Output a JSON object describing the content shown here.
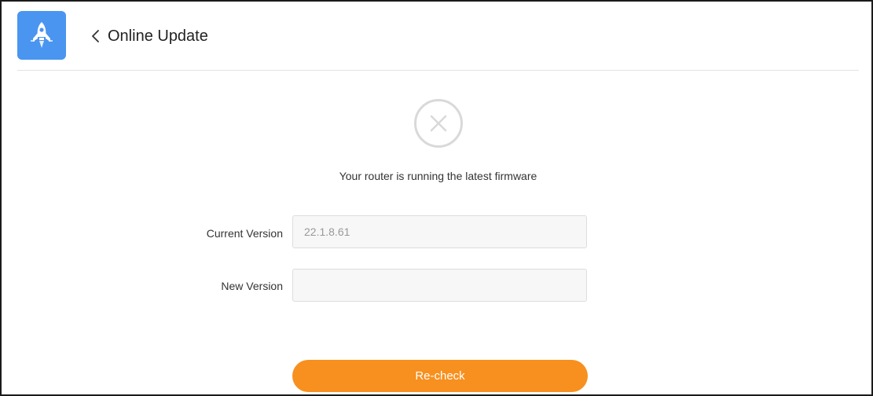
{
  "header": {
    "app_icon": "rocket-icon",
    "back_icon": "chevron-left-icon",
    "title": "Online Update"
  },
  "status": {
    "icon": "x-circle-icon",
    "message": "Your router is running the latest firmware"
  },
  "form": {
    "current_version": {
      "label": "Current Version",
      "value": "22.1.8.61"
    },
    "new_version": {
      "label": "New Version",
      "value": ""
    }
  },
  "actions": {
    "recheck_label": "Re-check"
  },
  "colors": {
    "app_icon_bg": "#4a95f0",
    "button_bg": "#f7901e",
    "status_icon": "#d9d9d9",
    "input_bg": "#f7f7f7"
  }
}
